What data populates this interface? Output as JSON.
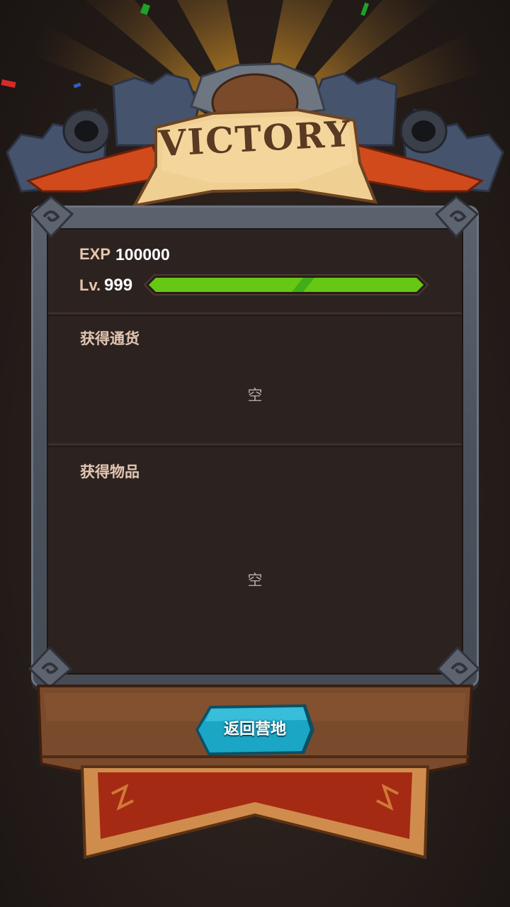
{
  "header": {
    "title": "VICTORY"
  },
  "stats": {
    "exp_label": "EXP",
    "exp_value": "100000",
    "level_prefix": "Lv.",
    "level_value": "999",
    "level_progress": 1.0
  },
  "currency_section": {
    "title": "获得通货",
    "empty_text": "空"
  },
  "items_section": {
    "title": "获得物品",
    "empty_text": "空"
  },
  "actions": {
    "return_label": "返回营地"
  },
  "colors": {
    "progress_fill": "#66c814",
    "progress_highlight": "#3fae17",
    "button_fill": "#1ba6c6",
    "banner_parchment": "#f0cf92",
    "frame_stone": "#555c67",
    "panel_bg": "#2c2320"
  }
}
